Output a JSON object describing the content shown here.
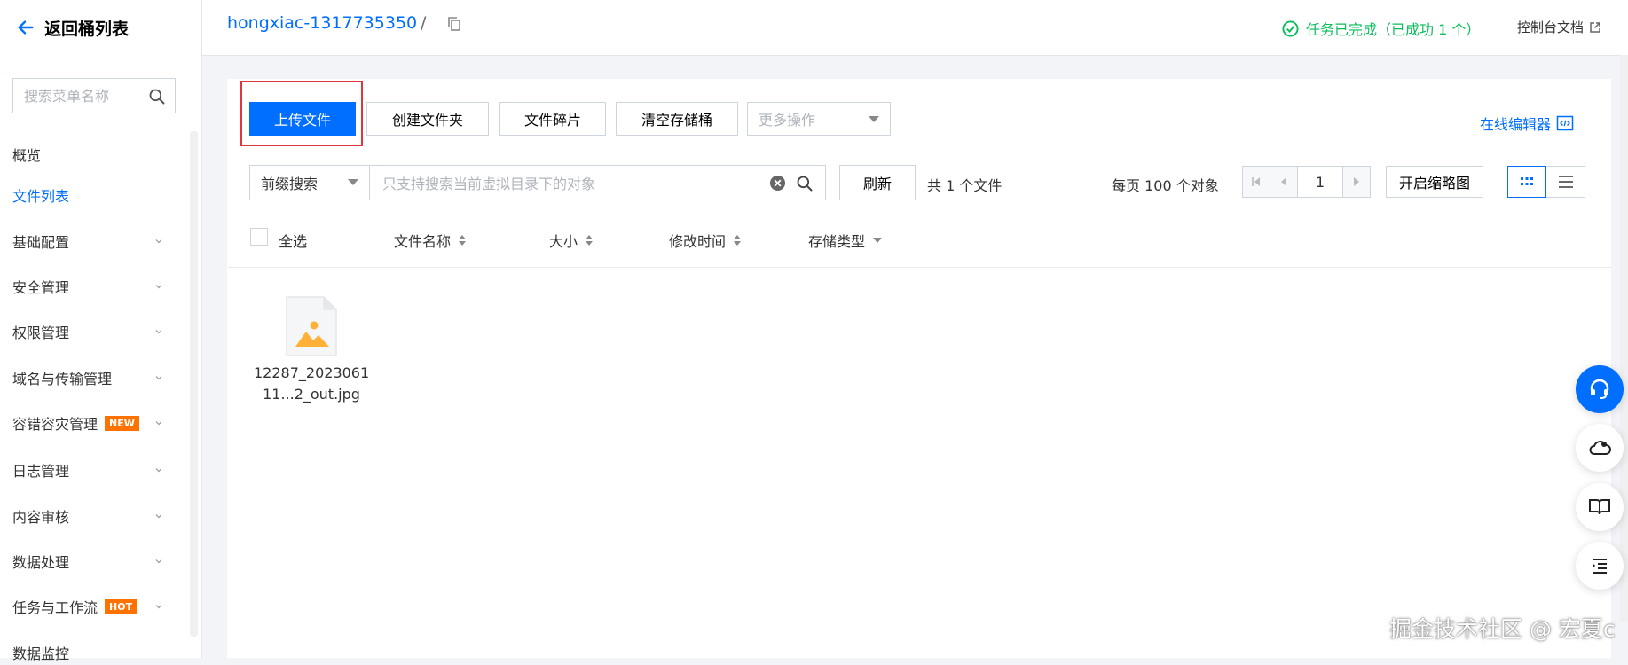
{
  "sidebar": {
    "back_label": "返回桶列表",
    "search_placeholder": "搜索菜单名称",
    "items": [
      {
        "label": "概览"
      },
      {
        "label": "文件列表"
      },
      {
        "label": "基础配置"
      },
      {
        "label": "安全管理"
      },
      {
        "label": "权限管理"
      },
      {
        "label": "域名与传输管理"
      },
      {
        "label": "容错容灾管理",
        "badge": "NEW"
      },
      {
        "label": "日志管理"
      },
      {
        "label": "内容审核"
      },
      {
        "label": "数据处理"
      },
      {
        "label": "任务与工作流",
        "badge": "HOT"
      },
      {
        "label": "数据监控"
      }
    ]
  },
  "header": {
    "bucket_name": "hongxiac-1317735350",
    "separator": "/",
    "task_status": "任务已完成（已成功 1 个）",
    "doc_link": "控制台文档"
  },
  "toolbar": {
    "upload": "上传文件",
    "create_folder": "创建文件夹",
    "fragments": "文件碎片",
    "clear_bucket": "清空存储桶",
    "more_ops": "更多操作",
    "online_editor": "在线编辑器"
  },
  "filter": {
    "search_type": "前缀搜索",
    "search_placeholder": "只支持搜索当前虚拟目录下的对象",
    "refresh": "刷新",
    "file_count": "共 1 个文件",
    "per_page": "每页 100 个对象",
    "page": "1",
    "thumbnail": "开启缩略图"
  },
  "columns": {
    "select_all": "全选",
    "name": "文件名称",
    "size": "大小",
    "modified": "修改时间",
    "storage_class": "存储类型"
  },
  "files": [
    {
      "name_line1": "12287_2023061",
      "name_line2": "11...2_out.jpg"
    }
  ],
  "watermark": "掘金技术社区 @ 宏夏c",
  "colors": {
    "accent": "#006eff",
    "success": "#0abf5b",
    "badge": "#ff7200",
    "highlight": "#e0373d"
  }
}
